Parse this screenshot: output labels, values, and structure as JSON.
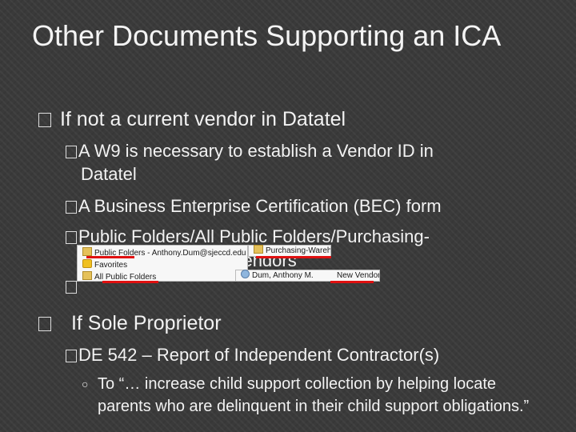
{
  "slide": {
    "title": "Other Documents Supporting an ICA",
    "bullet1": {
      "marker": "�",
      "text": "If not a current vendor in Datatel",
      "items": [
        {
          "marker": "�",
          "text": "A W9 is necessary to establish a Vendor ID in",
          "cont": "Datatel"
        },
        {
          "marker": "�",
          "text": "A Business Enterprise Certification (BEC) form"
        },
        {
          "marker": "�",
          "text": "Public Folders/All Public Folders/Purchasing-",
          "cont": "w Vendors"
        },
        {
          "marker": "�",
          "text": ""
        }
      ]
    },
    "bullet2": {
      "marker": "�",
      "text": "If Sole Proprietor",
      "items": [
        {
          "marker": "�",
          "text": "DE 542 – Report of Independent Contractor(s)"
        }
      ],
      "subitems": [
        {
          "marker": "○",
          "text": "To “… increase child support collection by helping locate parents who are delinquent in their child support obligations.”"
        }
      ]
    }
  },
  "screenshots": {
    "left_panel": {
      "rows": [
        "Public Folders - Anthony.Dum@sjeccd.edu",
        "Favorites",
        "All Public Folders"
      ]
    },
    "right_panel": {
      "rows": [
        "Purchasing-Warehouse",
        "Dum, Anthony M.",
        "New Vendors"
      ]
    }
  },
  "colors": {
    "background": "#3a3a3a",
    "text": "#f2f2f2",
    "underline": "#e01010"
  }
}
